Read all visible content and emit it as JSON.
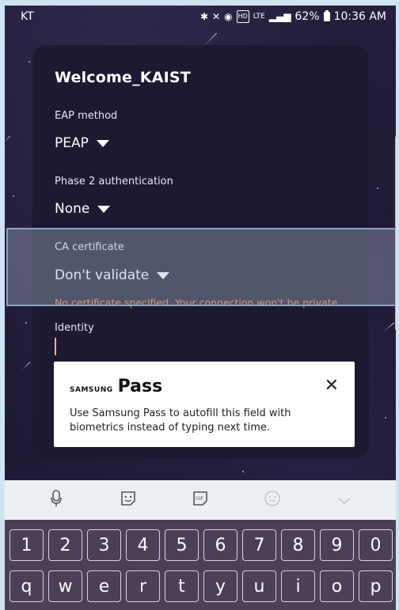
{
  "status_bar": {
    "carrier": "KT",
    "icons": [
      "bluetooth-icon",
      "mute-icon",
      "alarm-icon",
      "hd-icon",
      "lte-icon",
      "signal-icon"
    ],
    "lte_label": "LTE",
    "hd_label": "HD",
    "battery_percent": "62%",
    "time": "10:36 AM"
  },
  "dialog": {
    "title": "Welcome_KAIST",
    "fields": [
      {
        "label": "EAP method",
        "value": "PEAP"
      },
      {
        "label": "Phase 2 authentication",
        "value": "None"
      },
      {
        "label": "CA certificate",
        "value": "Don't validate"
      }
    ],
    "warning": "No certificate specified. Your connection won't be private.",
    "identity_label": "Identity",
    "identity_value": ""
  },
  "samsung_pass": {
    "brand": "SAMSUNG",
    "name": "Pass",
    "message": "Use Samsung Pass to autofill this field with biometrics instead of typing next time.",
    "close_glyph": "✕"
  },
  "keyboard": {
    "toolbar": [
      {
        "name": "microphone-icon",
        "glyph": "🎙"
      },
      {
        "name": "sticker-icon",
        "glyph": "☺"
      },
      {
        "name": "gif-icon",
        "glyph": "GIF"
      },
      {
        "name": "emoji-icon",
        "glyph": "☺"
      },
      {
        "name": "chevron-down-icon",
        "glyph": "⌄"
      }
    ],
    "number_row": [
      "1",
      "2",
      "3",
      "4",
      "5",
      "6",
      "7",
      "8",
      "9",
      "0"
    ],
    "letter_row": [
      "q",
      "w",
      "e",
      "r",
      "t",
      "y",
      "u",
      "i",
      "o",
      "p"
    ]
  },
  "colors": {
    "warning": "#ff7a48",
    "dialog_bg": "#1c1a30",
    "keyboard_bg": "#4b4056",
    "highlight_border": "#8da2bf"
  }
}
